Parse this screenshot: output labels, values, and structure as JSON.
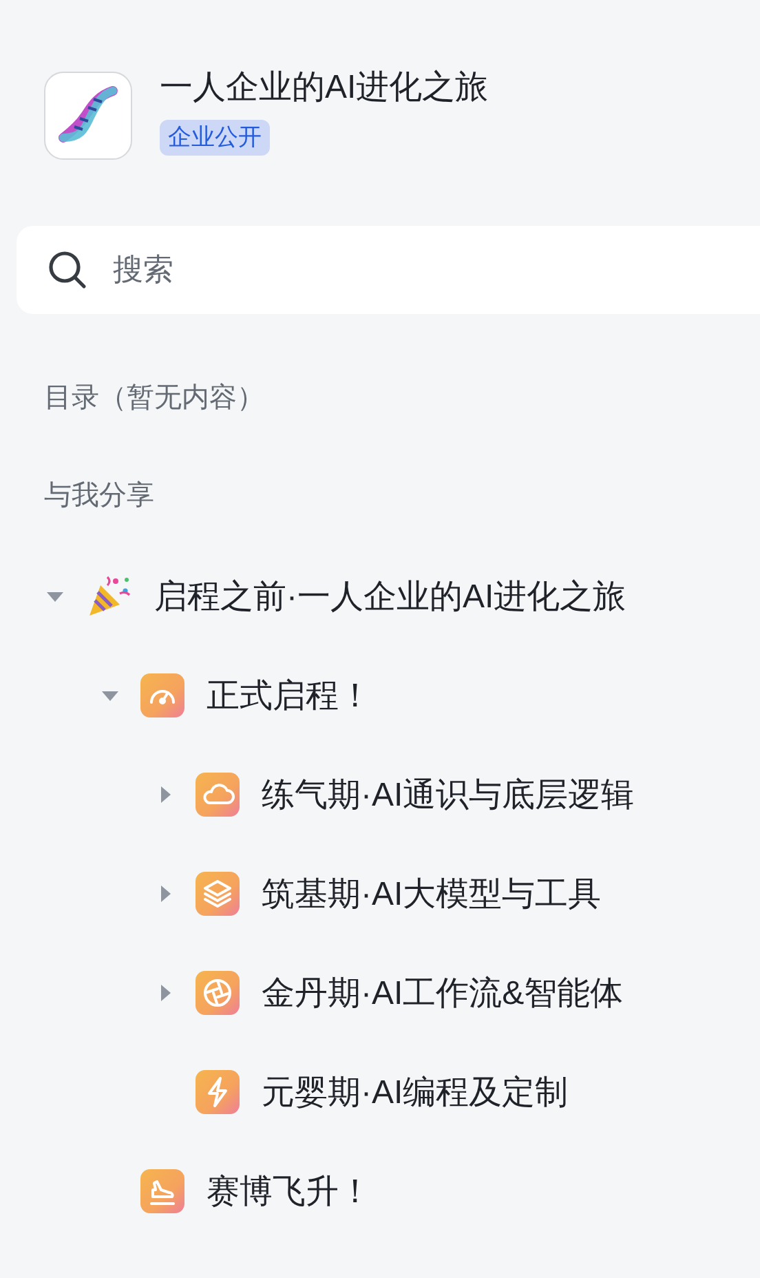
{
  "header": {
    "title": "一人企业的AI进化之旅",
    "badge": "企业公开"
  },
  "search": {
    "placeholder": "搜索"
  },
  "toc_label": "目录（暂无内容）",
  "shared_label": "与我分享",
  "tree": [
    {
      "label": "启程之前·一人企业的AI进化之旅",
      "expanded": true,
      "children": [
        {
          "label": "正式启程！",
          "expanded": true,
          "children": [
            {
              "label": "练气期·AI通识与底层逻辑",
              "expanded": false
            },
            {
              "label": "筑基期·AI大模型与工具",
              "expanded": false
            },
            {
              "label": "金丹期·AI工作流&智能体",
              "expanded": false
            },
            {
              "label": "元婴期·AI编程及定制"
            }
          ]
        },
        {
          "label": "赛博飞升！"
        }
      ]
    }
  ]
}
